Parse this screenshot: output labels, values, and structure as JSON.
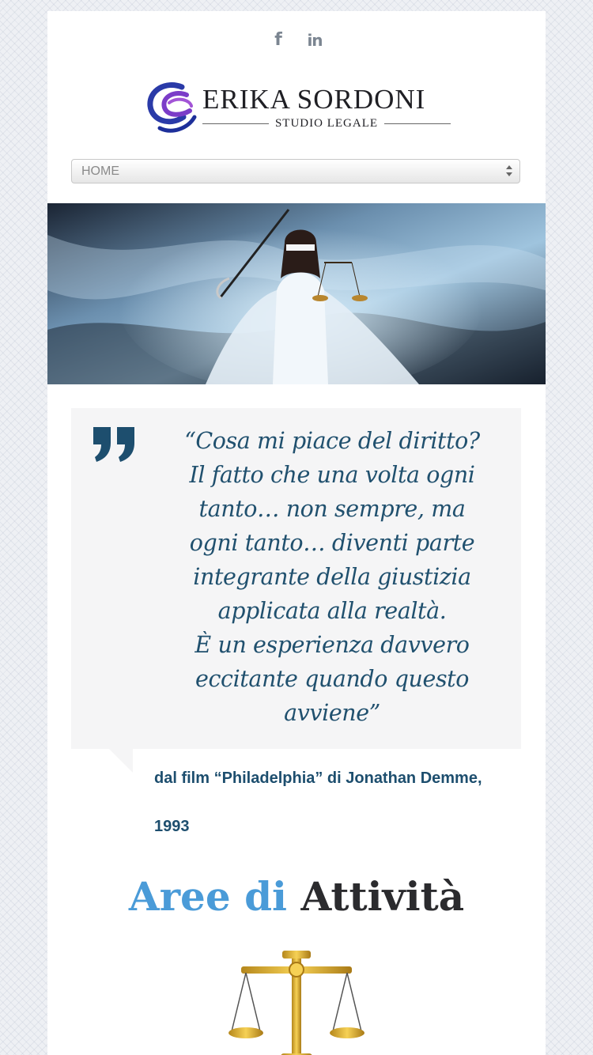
{
  "social": {
    "facebook_icon": "f",
    "linkedin_icon": "in"
  },
  "logo": {
    "name": "ERIKA SORDONI",
    "subtitle": "STUDIO LEGALE"
  },
  "nav": {
    "selected": "HOME"
  },
  "quote": {
    "lines": [
      "“Cosa mi piace del diritto?",
      "Il fatto che una volta ogni",
      "tanto… non sempre, ma",
      "ogni tanto… diventi parte",
      "integrante della giustizia",
      "applicata alla realtà.",
      "È un esperienza davvero",
      "eccitante quando questo",
      "avviene”"
    ],
    "source_line1": "dal film “Philadelphia” di Jonathan Demme,",
    "source_line2": "1993"
  },
  "section": {
    "title_part1": "Aree di",
    "title_part2": "Attività"
  },
  "colors": {
    "quote_text": "#20506e",
    "accent_blue": "#4a9bd8",
    "title_dark": "#2b2b2e",
    "quote_bg": "#f5f5f6"
  }
}
